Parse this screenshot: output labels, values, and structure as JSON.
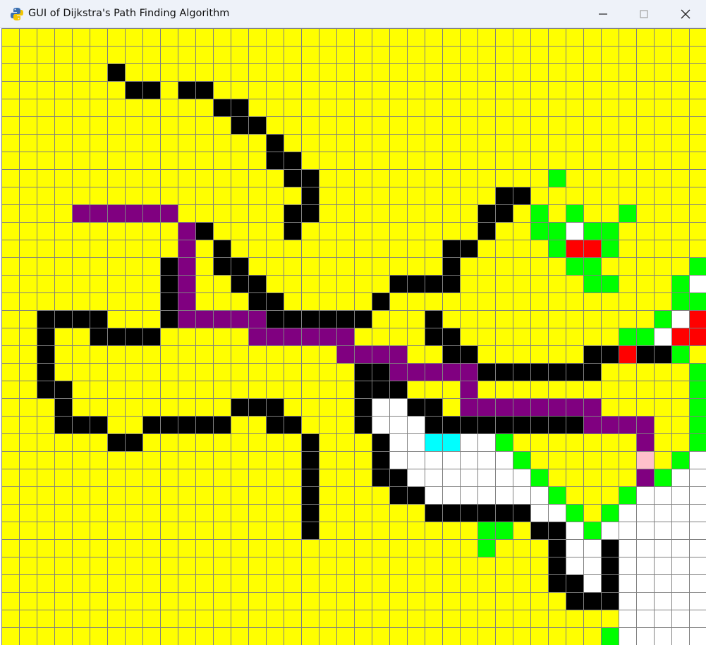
{
  "window": {
    "title": "GUI of Dijkstra's Path Finding Algorithm",
    "app_icon": "python-logo-icon",
    "controls": [
      "minimize-icon",
      "maximize-icon",
      "close-icon"
    ]
  },
  "colors": {
    "unvisited": "#ffff00",
    "barrier": "#000000",
    "open_set": "#00ff00",
    "closed_set": "#ffffff",
    "path": "#800080",
    "start": "#ffc0cb",
    "end": "#00ffff",
    "current": "#ff0000",
    "grid_line": "#808080"
  },
  "grid": {
    "rows": 35,
    "cols": 40,
    "barrier": [
      [
        2,
        6
      ],
      [
        3,
        7
      ],
      [
        3,
        8
      ],
      [
        3,
        10
      ],
      [
        3,
        11
      ],
      [
        4,
        12
      ],
      [
        4,
        13
      ],
      [
        5,
        13
      ],
      [
        5,
        14
      ],
      [
        6,
        15
      ],
      [
        7,
        15
      ],
      [
        7,
        16
      ],
      [
        8,
        16
      ],
      [
        8,
        17
      ],
      [
        9,
        17
      ],
      [
        9,
        28
      ],
      [
        9,
        29
      ],
      [
        10,
        16
      ],
      [
        10,
        17
      ],
      [
        10,
        27
      ],
      [
        10,
        28
      ],
      [
        11,
        11
      ],
      [
        11,
        16
      ],
      [
        11,
        27
      ],
      [
        12,
        12
      ],
      [
        12,
        25
      ],
      [
        12,
        26
      ],
      [
        13,
        9
      ],
      [
        13,
        12
      ],
      [
        13,
        13
      ],
      [
        13,
        25
      ],
      [
        14,
        9
      ],
      [
        14,
        13
      ],
      [
        14,
        14
      ],
      [
        14,
        22
      ],
      [
        14,
        23
      ],
      [
        14,
        24
      ],
      [
        14,
        25
      ],
      [
        15,
        9
      ],
      [
        15,
        14
      ],
      [
        15,
        15
      ],
      [
        15,
        21
      ],
      [
        16,
        2
      ],
      [
        16,
        3
      ],
      [
        16,
        4
      ],
      [
        16,
        5
      ],
      [
        16,
        9
      ],
      [
        16,
        15
      ],
      [
        16,
        16
      ],
      [
        16,
        17
      ],
      [
        16,
        18
      ],
      [
        16,
        19
      ],
      [
        16,
        20
      ],
      [
        16,
        24
      ],
      [
        17,
        2
      ],
      [
        17,
        5
      ],
      [
        17,
        6
      ],
      [
        17,
        7
      ],
      [
        17,
        8
      ],
      [
        17,
        24
      ],
      [
        17,
        25
      ],
      [
        18,
        2
      ],
      [
        18,
        25
      ],
      [
        18,
        26
      ],
      [
        18,
        33
      ],
      [
        18,
        34
      ],
      [
        18,
        35
      ],
      [
        18,
        36
      ],
      [
        18,
        37
      ],
      [
        19,
        2
      ],
      [
        19,
        20
      ],
      [
        19,
        21
      ],
      [
        19,
        27
      ],
      [
        19,
        28
      ],
      [
        19,
        29
      ],
      [
        19,
        30
      ],
      [
        19,
        31
      ],
      [
        19,
        32
      ],
      [
        19,
        33
      ],
      [
        20,
        2
      ],
      [
        20,
        3
      ],
      [
        20,
        20
      ],
      [
        20,
        21
      ],
      [
        20,
        22
      ],
      [
        21,
        3
      ],
      [
        21,
        13
      ],
      [
        21,
        14
      ],
      [
        21,
        15
      ],
      [
        21,
        20
      ],
      [
        21,
        23
      ],
      [
        21,
        24
      ],
      [
        22,
        3
      ],
      [
        22,
        4
      ],
      [
        22,
        5
      ],
      [
        22,
        8
      ],
      [
        22,
        9
      ],
      [
        22,
        10
      ],
      [
        22,
        11
      ],
      [
        22,
        12
      ],
      [
        22,
        15
      ],
      [
        22,
        16
      ],
      [
        22,
        20
      ],
      [
        22,
        24
      ],
      [
        22,
        25
      ],
      [
        22,
        26
      ],
      [
        22,
        27
      ],
      [
        22,
        28
      ],
      [
        22,
        29
      ],
      [
        22,
        30
      ],
      [
        22,
        31
      ],
      [
        22,
        32
      ],
      [
        23,
        6
      ],
      [
        23,
        7
      ],
      [
        23,
        17
      ],
      [
        23,
        21
      ],
      [
        24,
        17
      ],
      [
        24,
        21
      ],
      [
        25,
        17
      ],
      [
        25,
        21
      ],
      [
        25,
        22
      ],
      [
        26,
        17
      ],
      [
        26,
        22
      ],
      [
        26,
        23
      ],
      [
        27,
        17
      ],
      [
        27,
        24
      ],
      [
        27,
        25
      ],
      [
        27,
        26
      ],
      [
        27,
        27
      ],
      [
        27,
        28
      ],
      [
        27,
        29
      ],
      [
        28,
        17
      ],
      [
        28,
        30
      ],
      [
        28,
        31
      ],
      [
        29,
        31
      ],
      [
        29,
        34
      ],
      [
        30,
        31
      ],
      [
        30,
        34
      ],
      [
        31,
        31
      ],
      [
        31,
        32
      ],
      [
        31,
        34
      ],
      [
        32,
        32
      ],
      [
        32,
        33
      ],
      [
        32,
        34
      ]
    ],
    "path": [
      [
        10,
        4
      ],
      [
        10,
        5
      ],
      [
        10,
        6
      ],
      [
        10,
        7
      ],
      [
        10,
        8
      ],
      [
        10,
        9
      ],
      [
        11,
        10
      ],
      [
        12,
        10
      ],
      [
        13,
        10
      ],
      [
        14,
        10
      ],
      [
        15,
        10
      ],
      [
        16,
        10
      ],
      [
        16,
        11
      ],
      [
        16,
        12
      ],
      [
        16,
        13
      ],
      [
        16,
        14
      ],
      [
        17,
        14
      ],
      [
        17,
        15
      ],
      [
        17,
        16
      ],
      [
        17,
        17
      ],
      [
        17,
        18
      ],
      [
        17,
        19
      ],
      [
        18,
        19
      ],
      [
        18,
        20
      ],
      [
        18,
        21
      ],
      [
        18,
        22
      ],
      [
        19,
        22
      ],
      [
        19,
        23
      ],
      [
        19,
        24
      ],
      [
        19,
        25
      ],
      [
        19,
        26
      ],
      [
        20,
        26
      ],
      [
        21,
        26
      ],
      [
        21,
        27
      ],
      [
        21,
        28
      ],
      [
        21,
        29
      ],
      [
        21,
        30
      ],
      [
        21,
        31
      ],
      [
        21,
        32
      ],
      [
        21,
        33
      ],
      [
        22,
        33
      ],
      [
        22,
        34
      ],
      [
        22,
        35
      ],
      [
        22,
        36
      ],
      [
        23,
        36
      ],
      [
        24,
        36
      ],
      [
        25,
        36
      ]
    ],
    "open_set": [
      [
        8,
        31
      ],
      [
        10,
        30
      ],
      [
        10,
        32
      ],
      [
        10,
        35
      ],
      [
        11,
        30
      ],
      [
        11,
        31
      ],
      [
        11,
        33
      ],
      [
        11,
        34
      ],
      [
        12,
        31
      ],
      [
        12,
        34
      ],
      [
        13,
        32
      ],
      [
        13,
        33
      ],
      [
        13,
        39
      ],
      [
        14,
        33
      ],
      [
        14,
        34
      ],
      [
        14,
        38
      ],
      [
        15,
        38
      ],
      [
        15,
        39
      ],
      [
        16,
        37
      ],
      [
        17,
        35
      ],
      [
        17,
        36
      ],
      [
        18,
        34
      ],
      [
        18,
        38
      ],
      [
        19,
        39
      ],
      [
        20,
        39
      ],
      [
        21,
        39
      ],
      [
        22,
        39
      ],
      [
        23,
        28
      ],
      [
        23,
        39
      ],
      [
        24,
        29
      ],
      [
        24,
        38
      ],
      [
        25,
        30
      ],
      [
        25,
        37
      ],
      [
        26,
        31
      ],
      [
        26,
        35
      ],
      [
        27,
        32
      ],
      [
        27,
        34
      ],
      [
        28,
        27
      ],
      [
        28,
        28
      ],
      [
        28,
        33
      ],
      [
        29,
        27
      ],
      [
        34,
        34
      ]
    ],
    "closed_set": [
      [
        11,
        32
      ],
      [
        14,
        39
      ],
      [
        15,
        39
      ],
      [
        16,
        38
      ],
      [
        17,
        36
      ],
      [
        17,
        37
      ],
      [
        17,
        38
      ],
      [
        21,
        21
      ],
      [
        21,
        22
      ],
      [
        22,
        21
      ],
      [
        22,
        22
      ],
      [
        22,
        23
      ],
      [
        23,
        22
      ],
      [
        23,
        23
      ],
      [
        23,
        24
      ],
      [
        23,
        25
      ],
      [
        23,
        26
      ],
      [
        23,
        27
      ],
      [
        24,
        22
      ],
      [
        24,
        23
      ],
      [
        24,
        24
      ],
      [
        24,
        25
      ],
      [
        24,
        26
      ],
      [
        24,
        27
      ],
      [
        24,
        28
      ],
      [
        24,
        39
      ],
      [
        25,
        23
      ],
      [
        25,
        24
      ],
      [
        25,
        25
      ],
      [
        25,
        26
      ],
      [
        25,
        27
      ],
      [
        25,
        28
      ],
      [
        25,
        29
      ],
      [
        25,
        38
      ],
      [
        25,
        39
      ],
      [
        26,
        24
      ],
      [
        26,
        25
      ],
      [
        26,
        26
      ],
      [
        26,
        27
      ],
      [
        26,
        28
      ],
      [
        26,
        29
      ],
      [
        26,
        30
      ],
      [
        26,
        36
      ],
      [
        26,
        37
      ],
      [
        26,
        38
      ],
      [
        26,
        39
      ],
      [
        27,
        30
      ],
      [
        27,
        31
      ],
      [
        27,
        35
      ],
      [
        27,
        36
      ],
      [
        27,
        37
      ],
      [
        27,
        38
      ],
      [
        27,
        39
      ],
      [
        28,
        32
      ],
      [
        28,
        34
      ],
      [
        28,
        35
      ],
      [
        28,
        36
      ],
      [
        28,
        37
      ],
      [
        28,
        38
      ],
      [
        28,
        39
      ],
      [
        29,
        32
      ],
      [
        29,
        33
      ],
      [
        29,
        35
      ],
      [
        29,
        36
      ],
      [
        29,
        37
      ],
      [
        29,
        38
      ],
      [
        29,
        39
      ],
      [
        30,
        32
      ],
      [
        30,
        33
      ],
      [
        30,
        35
      ],
      [
        30,
        36
      ],
      [
        30,
        37
      ],
      [
        30,
        38
      ],
      [
        30,
        39
      ],
      [
        31,
        33
      ],
      [
        31,
        35
      ],
      [
        31,
        36
      ],
      [
        31,
        37
      ],
      [
        31,
        38
      ],
      [
        31,
        39
      ],
      [
        32,
        35
      ],
      [
        32,
        36
      ],
      [
        32,
        37
      ],
      [
        32,
        38
      ],
      [
        32,
        39
      ],
      [
        33,
        35
      ],
      [
        33,
        36
      ],
      [
        33,
        37
      ],
      [
        33,
        38
      ],
      [
        33,
        39
      ],
      [
        34,
        35
      ],
      [
        34,
        36
      ],
      [
        34,
        37
      ],
      [
        34,
        38
      ],
      [
        34,
        39
      ]
    ],
    "current": [
      [
        12,
        32
      ],
      [
        12,
        33
      ],
      [
        16,
        39
      ],
      [
        17,
        38
      ],
      [
        17,
        39
      ],
      [
        18,
        35
      ]
    ],
    "start": [
      [
        24,
        36
      ]
    ],
    "end": [
      [
        23,
        24
      ],
      [
        23,
        25
      ]
    ]
  }
}
